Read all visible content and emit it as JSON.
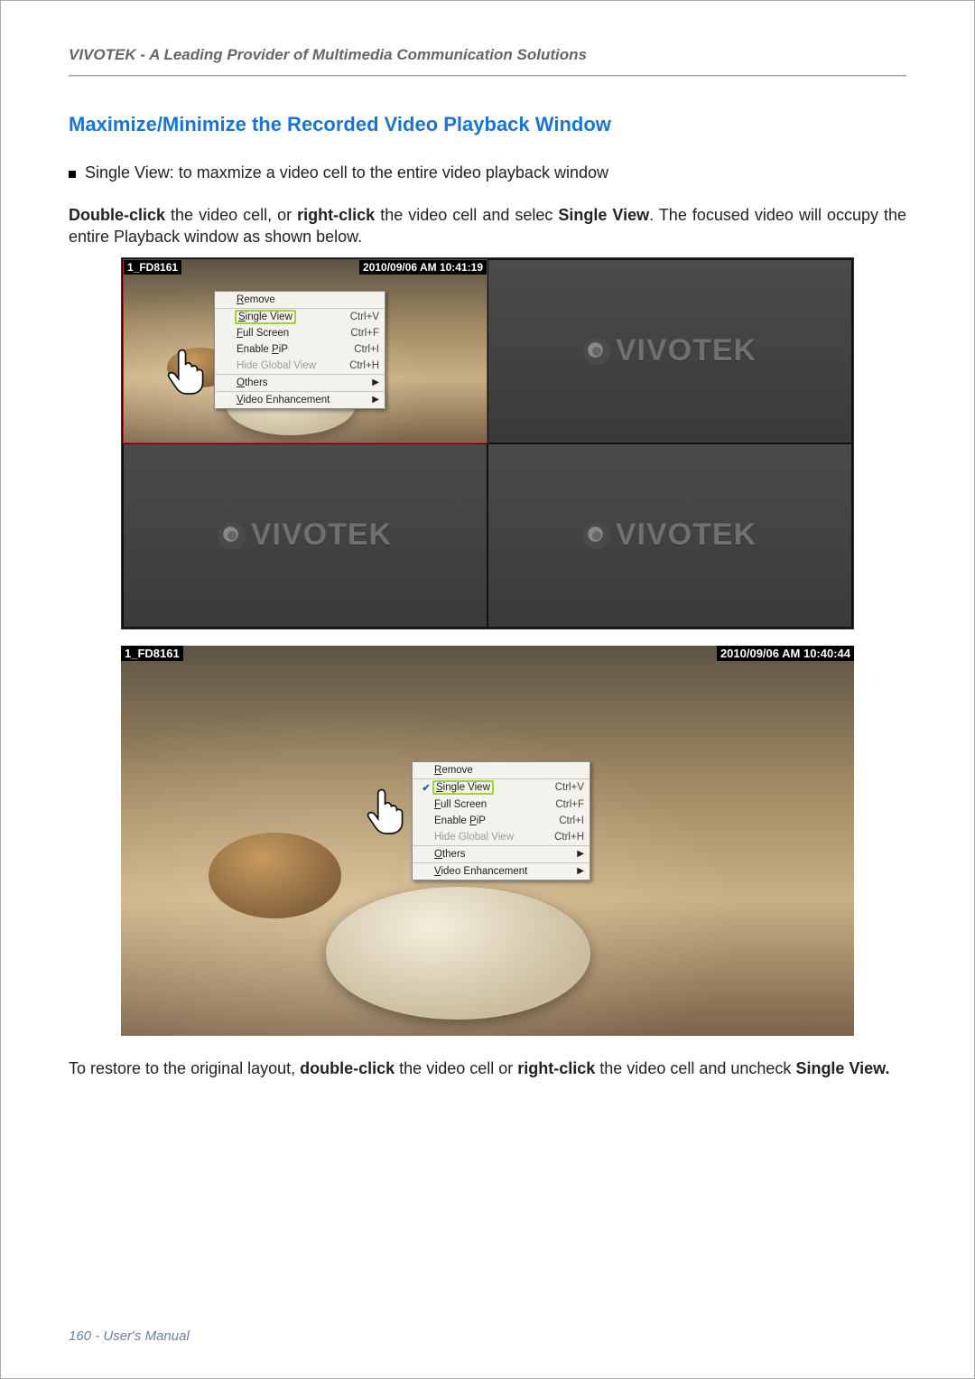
{
  "header": {
    "tagline": "VIVOTEK - A Leading Provider of Multimedia Communication Solutions"
  },
  "section": {
    "title": "Maximize/Minimize the Recorded Video Playback Window"
  },
  "bullet": {
    "single_view_desc": "Single View: to maxmize a video cell to the entire video playback window"
  },
  "para1": {
    "lead1": "Double-click",
    "mid1": " the video cell, or ",
    "lead2": "right-click",
    "mid2": " the video cell and selec ",
    "lead3": "Single View",
    "tail": ". The focused video will occupy the entire Playback window as shown below."
  },
  "para2": {
    "pre": "To restore to the original layout, ",
    "b1": "double-click",
    "mid1": " the video cell or ",
    "b2": "right-click",
    "mid2": " the video cell and uncheck ",
    "b3": "Single View."
  },
  "brand": {
    "name": "VIVOTEK"
  },
  "fig1": {
    "camera_label": "1_FD8161",
    "timestamp": "2010/09/06 AM 10:41:19",
    "menu": {
      "remove_u": "R",
      "remove_rest": "emove",
      "single_u": "S",
      "single_rest": "ingle View",
      "single_kb": "Ctrl+V",
      "full_u": "F",
      "full_rest": "ull Screen",
      "full_kb": "Ctrl+F",
      "pip_pre": "Enable ",
      "pip_u": "P",
      "pip_rest": "iP",
      "pip_kb": "Ctrl+I",
      "hide": "Hide Global View",
      "hide_kb": "Ctrl+H",
      "others_u": "O",
      "others_rest": "thers",
      "venh_u": "V",
      "venh_rest": "ideo Enhancement"
    }
  },
  "fig2": {
    "camera_label": "1_FD8161",
    "timestamp": "2010/09/06 AM 10:40:44",
    "menu": {
      "remove_u": "R",
      "remove_rest": "emove",
      "single_u": "S",
      "single_rest": "ingle View",
      "single_kb": "Ctrl+V",
      "full_u": "F",
      "full_rest": "ull Screen",
      "full_kb": "Ctrl+F",
      "pip_pre": "Enable ",
      "pip_u": "P",
      "pip_rest": "iP",
      "pip_kb": "Ctrl+I",
      "hide": "Hide Global View",
      "hide_kb": "Ctrl+H",
      "others_u": "O",
      "others_rest": "thers",
      "venh_u": "V",
      "venh_rest": "ideo Enhancement"
    }
  },
  "footer": {
    "page": "160",
    "sep": " - ",
    "label": "User's Manual"
  }
}
